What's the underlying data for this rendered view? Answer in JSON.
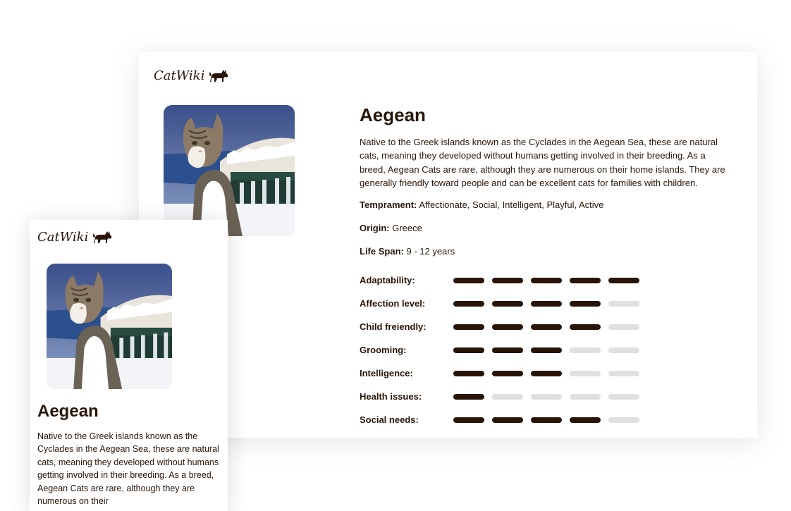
{
  "brand": {
    "name": "CatWiki",
    "icon": "cat-silhouette-icon"
  },
  "colors": {
    "primary": "#291507",
    "bar_off": "#e0e0e0"
  },
  "breed": {
    "name": "Aegean",
    "description": "Native to the Greek islands known as the Cyclades in the Aegean Sea, these are natural cats, meaning they developed without humans getting involved in their breeding. As a breed, Aegean Cats are rare, although they are numerous on their home islands. They are generally friendly toward people and can be excellent cats for families with children.",
    "mobile_description": "Native to the Greek islands known as the Cyclades in the Aegean Sea, these are natural cats, meaning they developed without humans getting involved in their breeding. As a breed, Aegean Cats are rare, although they are numerous on their",
    "facts": [
      {
        "label": "Temprament:",
        "value": "Affectionate, Social, Intelligent, Playful, Active"
      },
      {
        "label": "Origin:",
        "value": "Greece"
      },
      {
        "label": "Life Span:",
        "value": "9 - 12 years"
      }
    ],
    "ratings": [
      {
        "label": "Adaptability:",
        "value": 5,
        "max": 5
      },
      {
        "label": "Affection level:",
        "value": 4,
        "max": 5
      },
      {
        "label": "Child freiendly:",
        "value": 4,
        "max": 5
      },
      {
        "label": "Grooming:",
        "value": 3,
        "max": 5
      },
      {
        "label": "Intelligence:",
        "value": 3,
        "max": 5
      },
      {
        "label": "Health issues:",
        "value": 1,
        "max": 5
      },
      {
        "label": "Social needs:",
        "value": 4,
        "max": 5
      }
    ]
  }
}
